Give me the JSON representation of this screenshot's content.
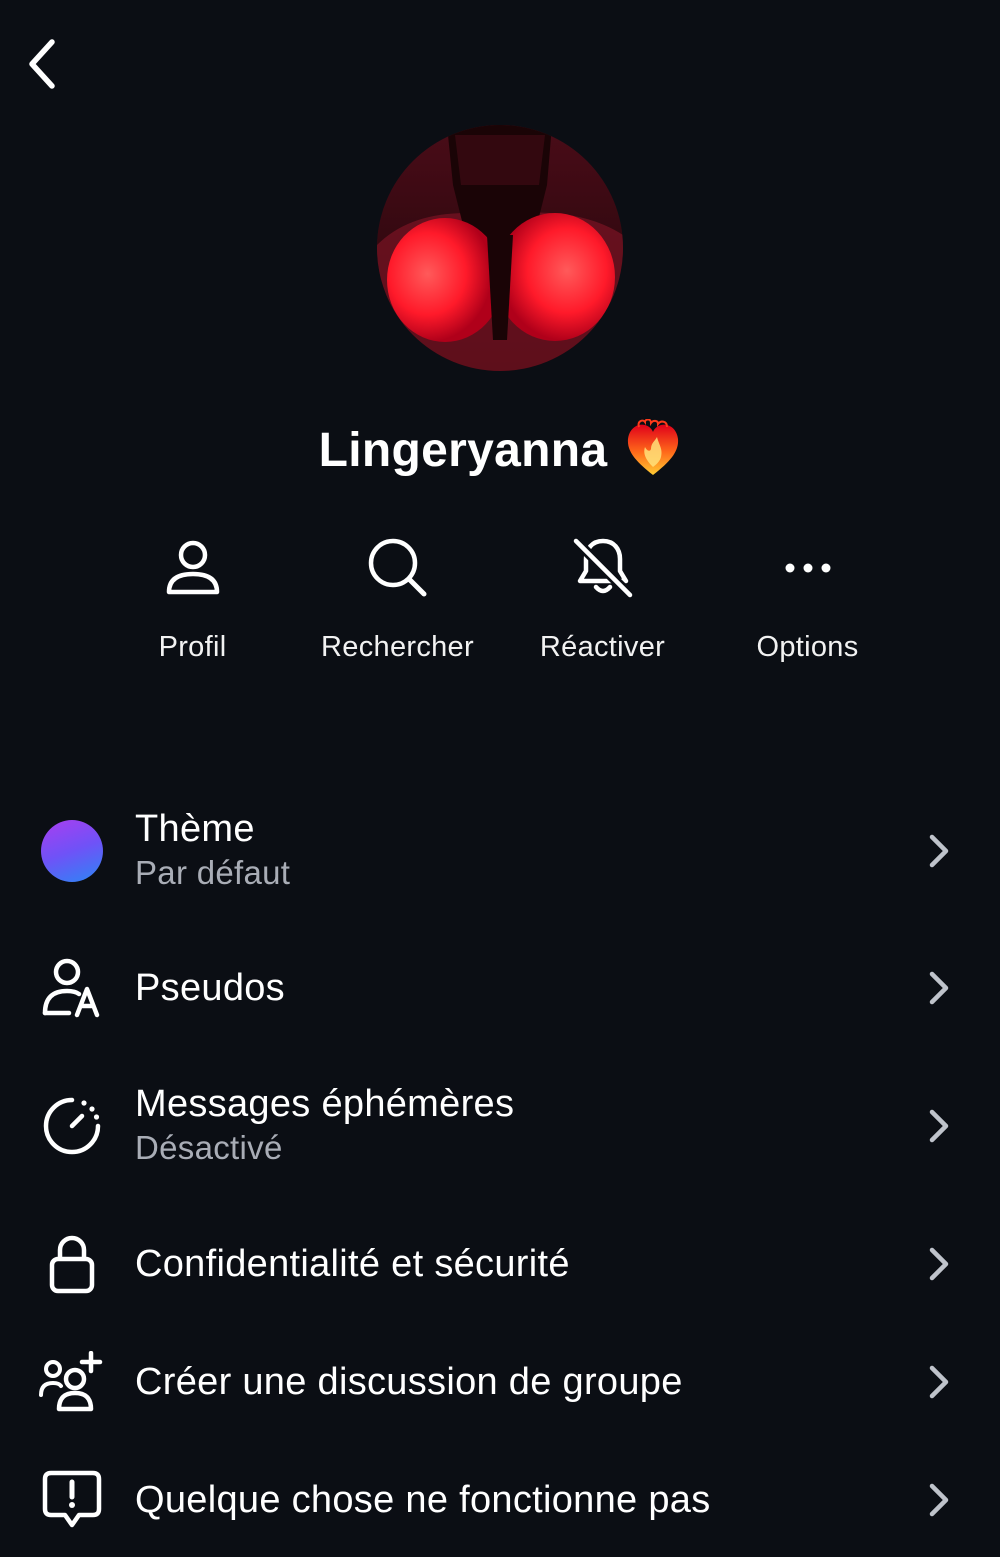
{
  "header": {
    "back_icon": "chevron-left-icon"
  },
  "profile": {
    "name": "Lingeryanna",
    "emoji": "❤️‍🔥",
    "avatar_colors": {
      "accent": "#ff2a3a",
      "dark": "#2a0810"
    }
  },
  "actions": [
    {
      "label": "Profil",
      "icon": "person-icon"
    },
    {
      "label": "Rechercher",
      "icon": "search-icon"
    },
    {
      "label": "Réactiver",
      "icon": "bell-off-icon"
    },
    {
      "label": "Options",
      "icon": "more-horizontal-icon"
    }
  ],
  "menu": [
    {
      "title": "Thème",
      "subtitle": "Par défaut",
      "icon": "theme-color-dot"
    },
    {
      "title": "Pseudos",
      "icon": "person-letter-a-icon"
    },
    {
      "title": "Messages éphémères",
      "subtitle": "Désactivé",
      "icon": "timer-icon"
    },
    {
      "title": "Confidentialité et sécurité",
      "icon": "lock-icon"
    },
    {
      "title": "Créer une discussion de groupe",
      "icon": "add-group-icon"
    },
    {
      "title": "Quelque chose ne fonctionne pas",
      "icon": "report-message-icon"
    }
  ],
  "colors": {
    "background": "#0b0e14",
    "text": "#ffffff",
    "secondary_text": "#a9adb6",
    "chevron": "#bfc3cb"
  }
}
